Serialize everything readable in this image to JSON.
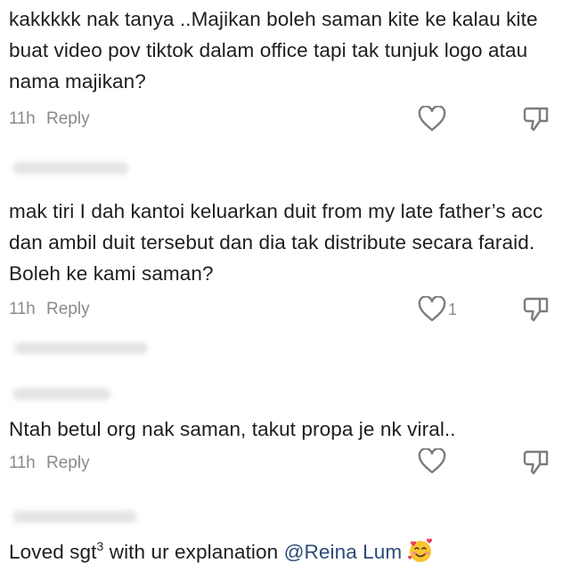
{
  "comments": [
    {
      "text": "kakkkkk nak tanya ..Majikan boleh saman kite ke kalau kite buat video pov tiktok dalam office tapi tak tunjuk logo atau nama majikan?",
      "time": "11h",
      "reply_label": "Reply",
      "likes": ""
    },
    {
      "text": "mak tiri I dah kantoi keluarkan duit from my late father’s acc dan ambil duit tersebut dan dia tak distribute secara faraid. Boleh ke kami saman?",
      "time": "11h",
      "reply_label": "Reply",
      "likes": "1"
    },
    {
      "text": "Ntah betul org nak saman, takut propa je nk viral..",
      "time": "11h",
      "reply_label": "Reply",
      "likes": ""
    },
    {
      "text_before": "Loved sgt",
      "superscript": "3",
      "text_after": " with ur explanation ",
      "mention": "@Reina Lum",
      "emoji": "smiling-face-with-hearts-icon"
    }
  ],
  "colors": {
    "text": "#1e1e1e",
    "meta": "#8a8a8a",
    "mention": "#2c4a7a",
    "icon": "#7c7c7c"
  }
}
